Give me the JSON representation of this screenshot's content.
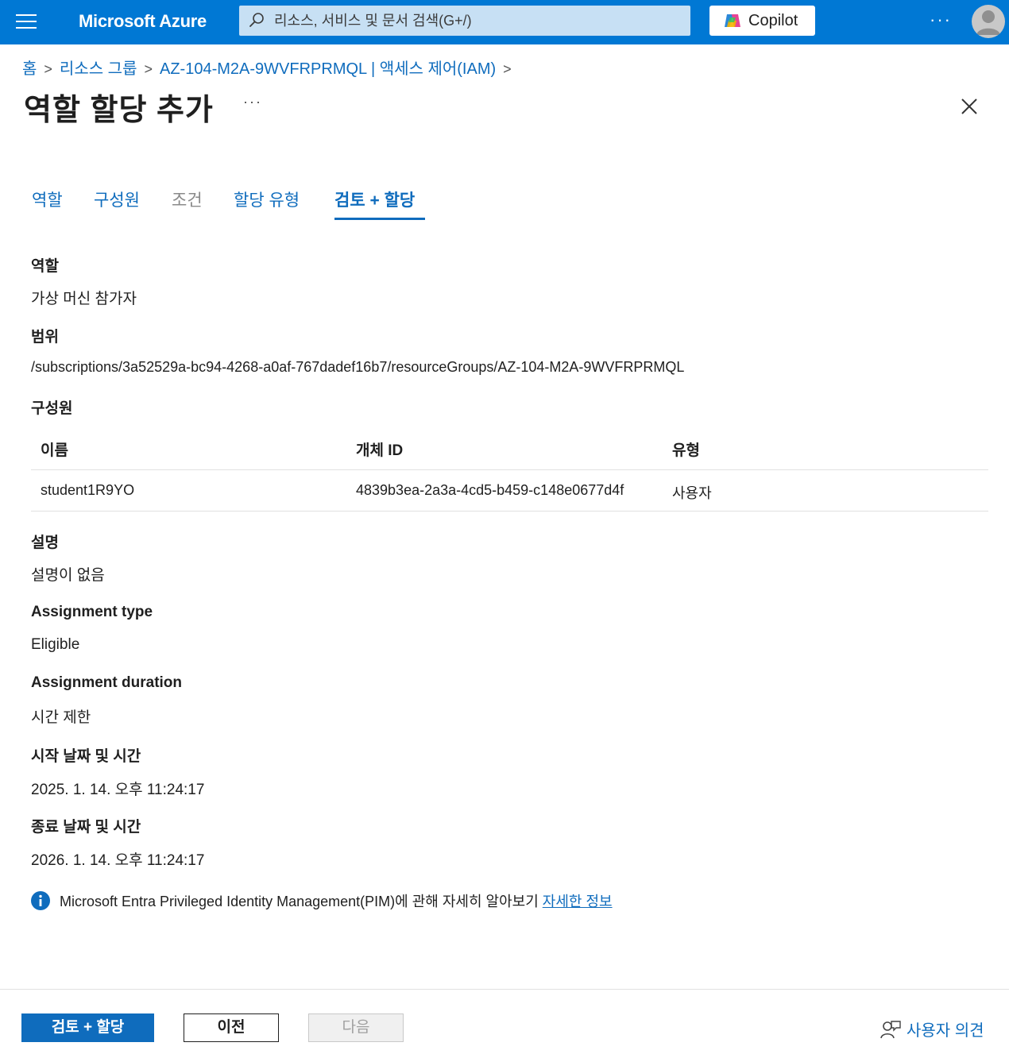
{
  "topbar": {
    "brand": "Microsoft Azure",
    "search_placeholder": "리소스, 서비스 및 문서 검색(G+/)",
    "copilot_label": "Copilot",
    "more": "···"
  },
  "breadcrumb": {
    "items": [
      "홈",
      "리소스 그룹",
      "AZ-104-M2A-9WVFRPRMQL | 액세스 제어(IAM)"
    ]
  },
  "page": {
    "title": "역할 할당 추가",
    "more": "···"
  },
  "tabs": [
    {
      "label": "역할",
      "state": "link"
    },
    {
      "label": "구성원",
      "state": "link"
    },
    {
      "label": "조건",
      "state": "disabled"
    },
    {
      "label": "할당 유형",
      "state": "link"
    },
    {
      "label": "검토 + 할당",
      "state": "active"
    }
  ],
  "review": {
    "role_label": "역할",
    "role_value": "가상 머신 참가자",
    "scope_label": "범위",
    "scope_value": "/subscriptions/3a52529a-bc94-4268-a0af-767dadef16b7/resourceGroups/AZ-104-M2A-9WVFRPRMQL",
    "members_label": "구성원",
    "members_table": {
      "headers": [
        "이름",
        "개체 ID",
        "유형"
      ],
      "rows": [
        [
          "student1R9YO",
          "4839b3ea-2a3a-4cd5-b459-c148e0677d4f",
          "사용자"
        ]
      ]
    },
    "description_label": "설명",
    "description_value": "설명이 없음",
    "assignment_type_label": "Assignment type",
    "assignment_type_value": "Eligible",
    "assignment_duration_label": "Assignment duration",
    "assignment_duration_value": "시간 제한",
    "start_label": "시작 날짜 및 시간",
    "start_value": "2025. 1. 14. 오후 11:24:17",
    "end_label": "종료 날짜 및 시간",
    "end_value": "2026. 1. 14. 오후 11:24:17"
  },
  "info": {
    "text": "Microsoft Entra Privileged Identity Management(PIM)에 관해 자세히 알아보기 ",
    "link": "자세한 정보"
  },
  "footer": {
    "primary": "검토 + 할당",
    "previous": "이전",
    "next": "다음",
    "feedback": "사용자 의견"
  },
  "colors": {
    "topbar": "#0078d4",
    "accent": "#0f6cbd",
    "search_bg": "#c7e0f4"
  }
}
